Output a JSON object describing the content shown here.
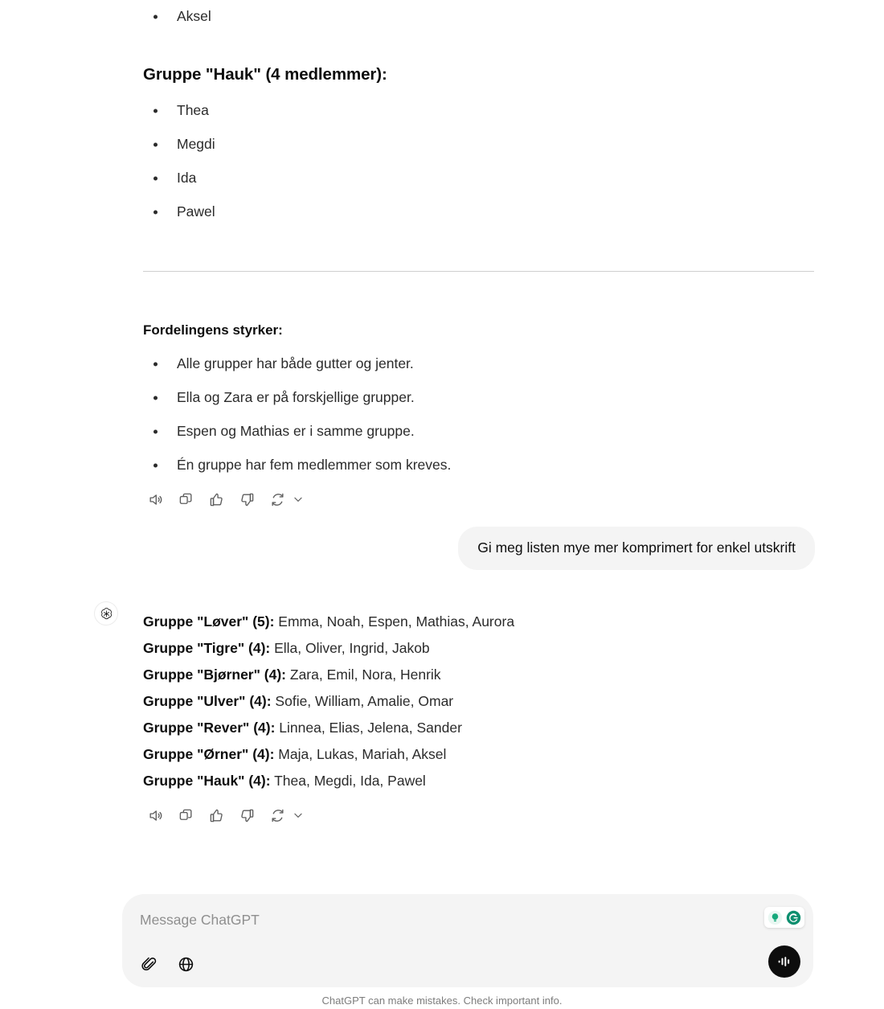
{
  "app": {
    "name": "ChatGPT",
    "disclaimer": "ChatGPT can make mistakes. Check important info."
  },
  "assistant_message_1": {
    "trailing_bullet": "Aksel",
    "group_heading": "Gruppe \"Hauk\" (4 medlemmer):",
    "group_members": [
      "Thea",
      "Megdi",
      "Ida",
      "Pawel"
    ],
    "strengths_heading": "Fordelingens styrker:",
    "strengths": [
      "Alle grupper har både gutter og jenter.",
      "Ella og Zara er på forskjellige grupper.",
      "Espen og Mathias er i samme gruppe.",
      "Én gruppe har fem medlemmer som kreves."
    ]
  },
  "user_message": {
    "text": "Gi meg listen mye mer komprimert for enkel utskrift"
  },
  "assistant_message_2": {
    "groups": [
      {
        "label": "Gruppe \"Løver\" (5):",
        "members": "Emma, Noah, Espen, Mathias, Aurora"
      },
      {
        "label": "Gruppe \"Tigre\" (4):",
        "members": "Ella, Oliver, Ingrid, Jakob"
      },
      {
        "label": "Gruppe \"Bjørner\" (4):",
        "members": "Zara, Emil, Nora, Henrik"
      },
      {
        "label": "Gruppe \"Ulver\" (4):",
        "members": "Sofie, William, Amalie, Omar"
      },
      {
        "label": "Gruppe \"Rever\" (4):",
        "members": "Linnea, Elias, Jelena, Sander"
      },
      {
        "label": "Gruppe \"Ørner\" (4):",
        "members": "Maja, Lukas, Mariah, Aksel"
      },
      {
        "label": "Gruppe \"Hauk\" (4):",
        "members": "Thea, Megdi, Ida, Pawel"
      }
    ]
  },
  "message_actions": {
    "read_aloud": "Read aloud",
    "copy": "Copy",
    "good_response": "Good response",
    "bad_response": "Bad response",
    "regenerate": "Regenerate",
    "more": "More"
  },
  "composer": {
    "placeholder": "Message ChatGPT",
    "attach_label": "Attach files",
    "search_web_label": "Search the web",
    "voice_label": "Use voice mode"
  },
  "grammarly": {
    "suggestion_label": "Grammarly suggestion",
    "logo_label": "Grammarly",
    "accent": "#15a97b",
    "accent_dark": "#0d8f6f"
  },
  "colors": {
    "page_background": "#ffffff",
    "body_text": "#2b2b2b",
    "strong_text": "#0d0d0d",
    "muted_text": "#8f8f8f",
    "bubble_background": "#f4f4f4",
    "divider": "#cfcfcf"
  }
}
